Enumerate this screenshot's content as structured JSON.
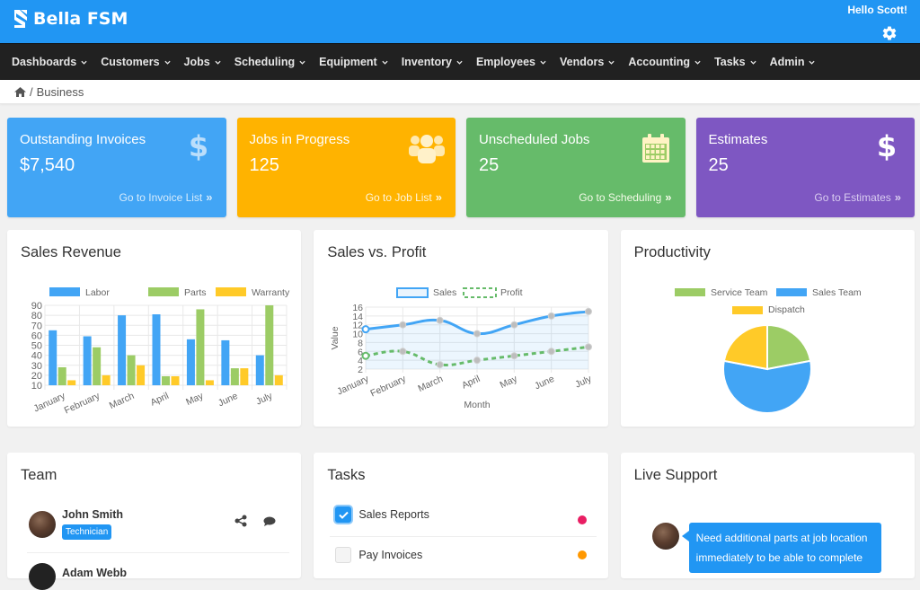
{
  "app": {
    "title": "Bella FSM",
    "greeting": "Hello Scott!",
    "settings_icon": "gear-icon"
  },
  "nav": {
    "items": [
      {
        "label": "Dashboards"
      },
      {
        "label": "Customers"
      },
      {
        "label": "Jobs"
      },
      {
        "label": "Scheduling"
      },
      {
        "label": "Equipment"
      },
      {
        "label": "Inventory"
      },
      {
        "label": "Employees"
      },
      {
        "label": "Vendors"
      },
      {
        "label": "Accounting"
      },
      {
        "label": "Tasks"
      },
      {
        "label": "Admin"
      }
    ]
  },
  "breadcrumb": {
    "home_icon": "home-icon",
    "separator": "/",
    "current": "Business"
  },
  "cards": [
    {
      "title": "Outstanding Invoices",
      "value": "$7,540",
      "link": "Go to Invoice List",
      "icon": "dollar-icon",
      "color": "#42a5f5"
    },
    {
      "title": "Jobs in Progress",
      "value": "125",
      "link": "Go to Job List",
      "icon": "users-icon",
      "color": "#ffb300"
    },
    {
      "title": "Unscheduled Jobs",
      "value": "25",
      "link": "Go to Scheduling",
      "icon": "calendar-icon",
      "color": "#66bb6a"
    },
    {
      "title": "Estimates",
      "value": "25",
      "link": "Go to Estimates",
      "icon": "dollar-icon",
      "color": "#7e57c2"
    }
  ],
  "panels": {
    "sales_revenue": {
      "title": "Sales Revenue"
    },
    "sales_vs_profit": {
      "title": "Sales vs. Profit"
    },
    "productivity": {
      "title": "Productivity"
    },
    "team": {
      "title": "Team",
      "members": [
        {
          "name": "John Smith",
          "role": "Technician"
        },
        {
          "name": "Adam Webb",
          "role": ""
        }
      ]
    },
    "tasks": {
      "title": "Tasks",
      "items": [
        {
          "label": "Sales Reports",
          "checked": true,
          "color": "#e91e63"
        },
        {
          "label": "Pay Invoices",
          "checked": false,
          "color": "#ff9800"
        }
      ]
    },
    "live_support": {
      "title": "Live Support",
      "message_line1": "Need additional parts at job location",
      "message_line2": "immediately to be able to complete"
    }
  },
  "chart_data": [
    {
      "type": "bar",
      "title": "Sales Revenue",
      "categories": [
        "January",
        "February",
        "March",
        "April",
        "May",
        "June",
        "July"
      ],
      "series": [
        {
          "name": "Labor",
          "color": "#42a5f5",
          "values": [
            65,
            59,
            80,
            81,
            56,
            55,
            40
          ]
        },
        {
          "name": "Parts",
          "color": "#9ccc65",
          "values": [
            28,
            48,
            40,
            19,
            86,
            27,
            90
          ]
        },
        {
          "name": "Warranty",
          "color": "#ffca28",
          "values": [
            15,
            20,
            30,
            19,
            15,
            27,
            20
          ]
        }
      ],
      "ylim": [
        10,
        90
      ],
      "yticks": [
        10,
        20,
        30,
        40,
        50,
        60,
        70,
        80,
        90
      ],
      "legend": "top",
      "grid": true
    },
    {
      "type": "line",
      "title": "Sales vs. Profit",
      "categories": [
        "January",
        "February",
        "March",
        "April",
        "May",
        "June",
        "July"
      ],
      "series": [
        {
          "name": "Sales",
          "color": "#42a5f5",
          "style": "solid",
          "fill": true,
          "values": [
            11,
            12,
            13,
            10,
            12,
            14,
            15
          ]
        },
        {
          "name": "Profit",
          "color": "#66bb6a",
          "style": "dashed",
          "fill": false,
          "values": [
            5,
            6,
            3,
            4,
            5,
            6,
            7
          ]
        }
      ],
      "xlabel": "Month",
      "ylabel": "Value",
      "ylim": [
        2,
        16
      ],
      "yticks": [
        2,
        4,
        6,
        8,
        10,
        12,
        14,
        16
      ],
      "legend": "top",
      "grid": true
    },
    {
      "type": "pie",
      "title": "Productivity",
      "labels": [
        "Service Team",
        "Sales Team",
        "Dispatch"
      ],
      "colors": [
        "#9ccc65",
        "#42a5f5",
        "#ffca28"
      ],
      "values": [
        22,
        56,
        22
      ],
      "legend": "top"
    }
  ]
}
